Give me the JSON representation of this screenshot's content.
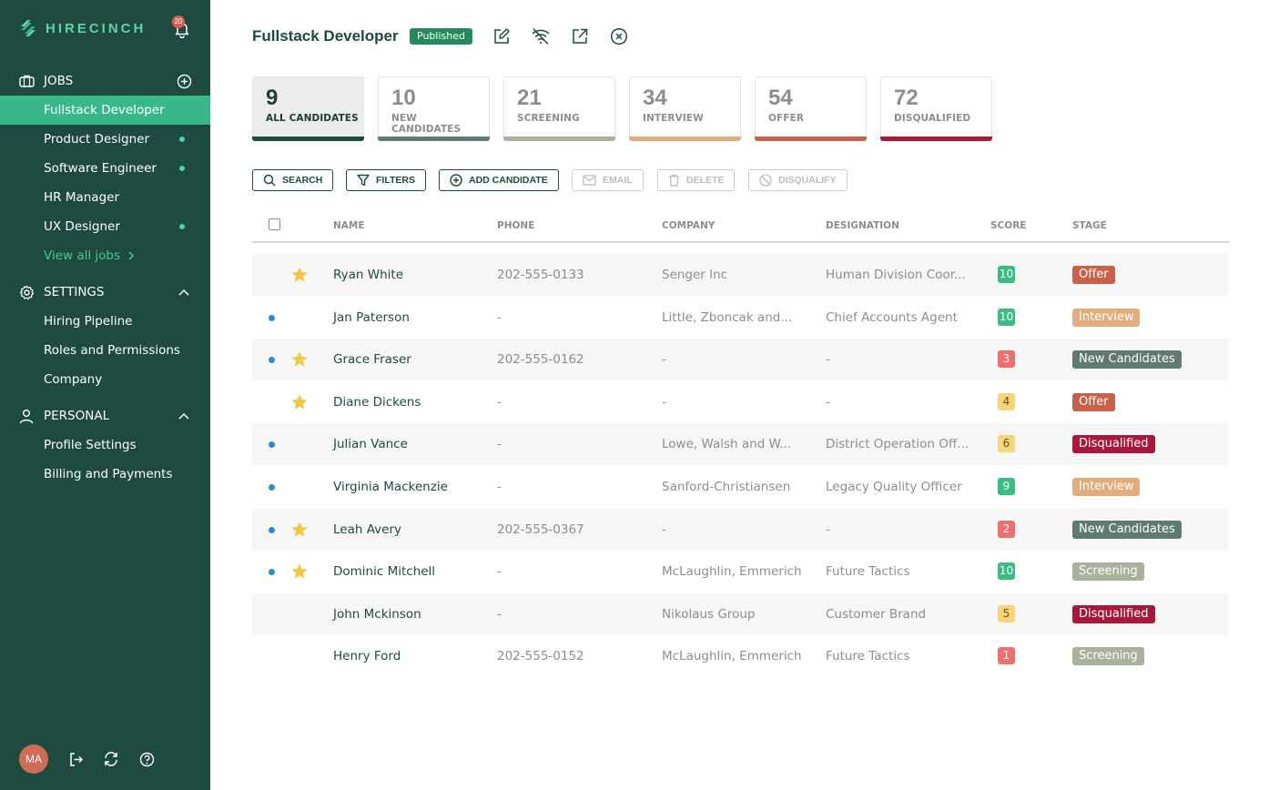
{
  "app": {
    "name": "HIRECINCH",
    "notifications": "20"
  },
  "sidebar": {
    "jobs": {
      "label": "JOBS",
      "items": [
        {
          "label": "Fullstack Developer",
          "active": true,
          "dot": false
        },
        {
          "label": "Product Designer",
          "active": false,
          "dot": true
        },
        {
          "label": "Software Engineer",
          "active": false,
          "dot": true
        },
        {
          "label": "HR Manager",
          "active": false,
          "dot": false
        },
        {
          "label": "UX Designer",
          "active": false,
          "dot": true
        }
      ],
      "view_all": "View all jobs"
    },
    "settings": {
      "label": "SETTINGS",
      "items": [
        {
          "label": "Hiring Pipeline"
        },
        {
          "label": "Roles and Permissions"
        },
        {
          "label": "Company"
        }
      ]
    },
    "personal": {
      "label": "PERSONAL",
      "items": [
        {
          "label": "Profile Settings"
        },
        {
          "label": "Billing and Payments"
        }
      ]
    },
    "user_initials": "MA"
  },
  "header": {
    "title": "Fullstack Developer",
    "status": "Published"
  },
  "stats": [
    {
      "count": "9",
      "label": "ALL CANDIDATES",
      "color": "#1e4a40",
      "active": true
    },
    {
      "count": "10",
      "label": "NEW CANDIDATES",
      "color": "#5f7a6f",
      "active": false
    },
    {
      "count": "21",
      "label": "SCREENING",
      "color": "#a9b09c",
      "active": false
    },
    {
      "count": "34",
      "label": "INTERVIEW",
      "color": "#e2ad7d",
      "active": false
    },
    {
      "count": "54",
      "label": "OFFER",
      "color": "#c9614a",
      "active": false
    },
    {
      "count": "72",
      "label": "DISQUALIFIED",
      "color": "#a8183c",
      "active": false
    }
  ],
  "toolbar": {
    "search": "SEARCH",
    "filters": "FILTERS",
    "add_candidate": "ADD CANDIDATE",
    "email": "EMAIL",
    "delete": "DELETE",
    "disqualify": "DISQUALIFY"
  },
  "table": {
    "columns": {
      "name": "NAME",
      "phone": "PHONE",
      "company": "COMPANY",
      "designation": "DESIGNATION",
      "score": "SCORE",
      "stage": "STAGE"
    },
    "rows": [
      {
        "dot": false,
        "star": true,
        "name": "Ryan White",
        "phone": "202-555-0133",
        "company": "Senger Inc",
        "designation": "Human Division Coor...",
        "score": "10",
        "stage": "Offer"
      },
      {
        "dot": true,
        "star": false,
        "name": "Jan Paterson",
        "phone": "-",
        "company": "Little, Zboncak and...",
        "designation": "Chief Accounts Agent",
        "score": "10",
        "stage": "Interview"
      },
      {
        "dot": true,
        "star": true,
        "name": "Grace Fraser",
        "phone": "202-555-0162",
        "company": "-",
        "designation": "-",
        "score": "3",
        "stage": "New Candidates"
      },
      {
        "dot": false,
        "star": true,
        "name": "Diane Dickens",
        "phone": "-",
        "company": "-",
        "designation": "-",
        "score": "4",
        "stage": "Offer"
      },
      {
        "dot": true,
        "star": false,
        "name": "Julian Vance",
        "phone": "-",
        "company": "Lowe, Walsh and W...",
        "designation": "District Operation Off...",
        "score": "6",
        "stage": "Disqualified"
      },
      {
        "dot": true,
        "star": false,
        "name": "Virginia Mackenzie",
        "phone": "-",
        "company": "Sanford-Christiansen",
        "designation": "Legacy Quality Officer",
        "score": "9",
        "stage": "Interview"
      },
      {
        "dot": true,
        "star": true,
        "name": "Leah Avery",
        "phone": "202-555-0367",
        "company": "-",
        "designation": "-",
        "score": "2",
        "stage": "New Candidates"
      },
      {
        "dot": true,
        "star": true,
        "name": "Dominic Mitchell",
        "phone": "-",
        "company": "McLaughlin, Emmerich",
        "designation": "Future Tactics",
        "score": "10",
        "stage": "Screening"
      },
      {
        "dot": false,
        "star": false,
        "name": "John Mckinson",
        "phone": "-",
        "company": "Nikolaus Group",
        "designation": "Customer Brand",
        "score": "5",
        "stage": "Disqualified"
      },
      {
        "dot": false,
        "star": false,
        "name": "Henry Ford",
        "phone": "202-555-0152",
        "company": "McLaughlin, Emmerich",
        "designation": "Future Tactics",
        "score": "1",
        "stage": "Screening"
      }
    ]
  },
  "stage_colors": {
    "Offer": "#c9614a",
    "Interview": "#e2ad7d",
    "New Candidates": "#5f7a6f",
    "Disqualified": "#a8183c",
    "Screening": "#a9b09c"
  },
  "score_colors": {
    "high": {
      "bg": "#3dbb84",
      "fg": "#ffffff"
    },
    "mid": {
      "bg": "#f7d57a",
      "fg": "#6b5314"
    },
    "low": {
      "bg": "#ef6f6f",
      "fg": "#ffffff"
    }
  }
}
